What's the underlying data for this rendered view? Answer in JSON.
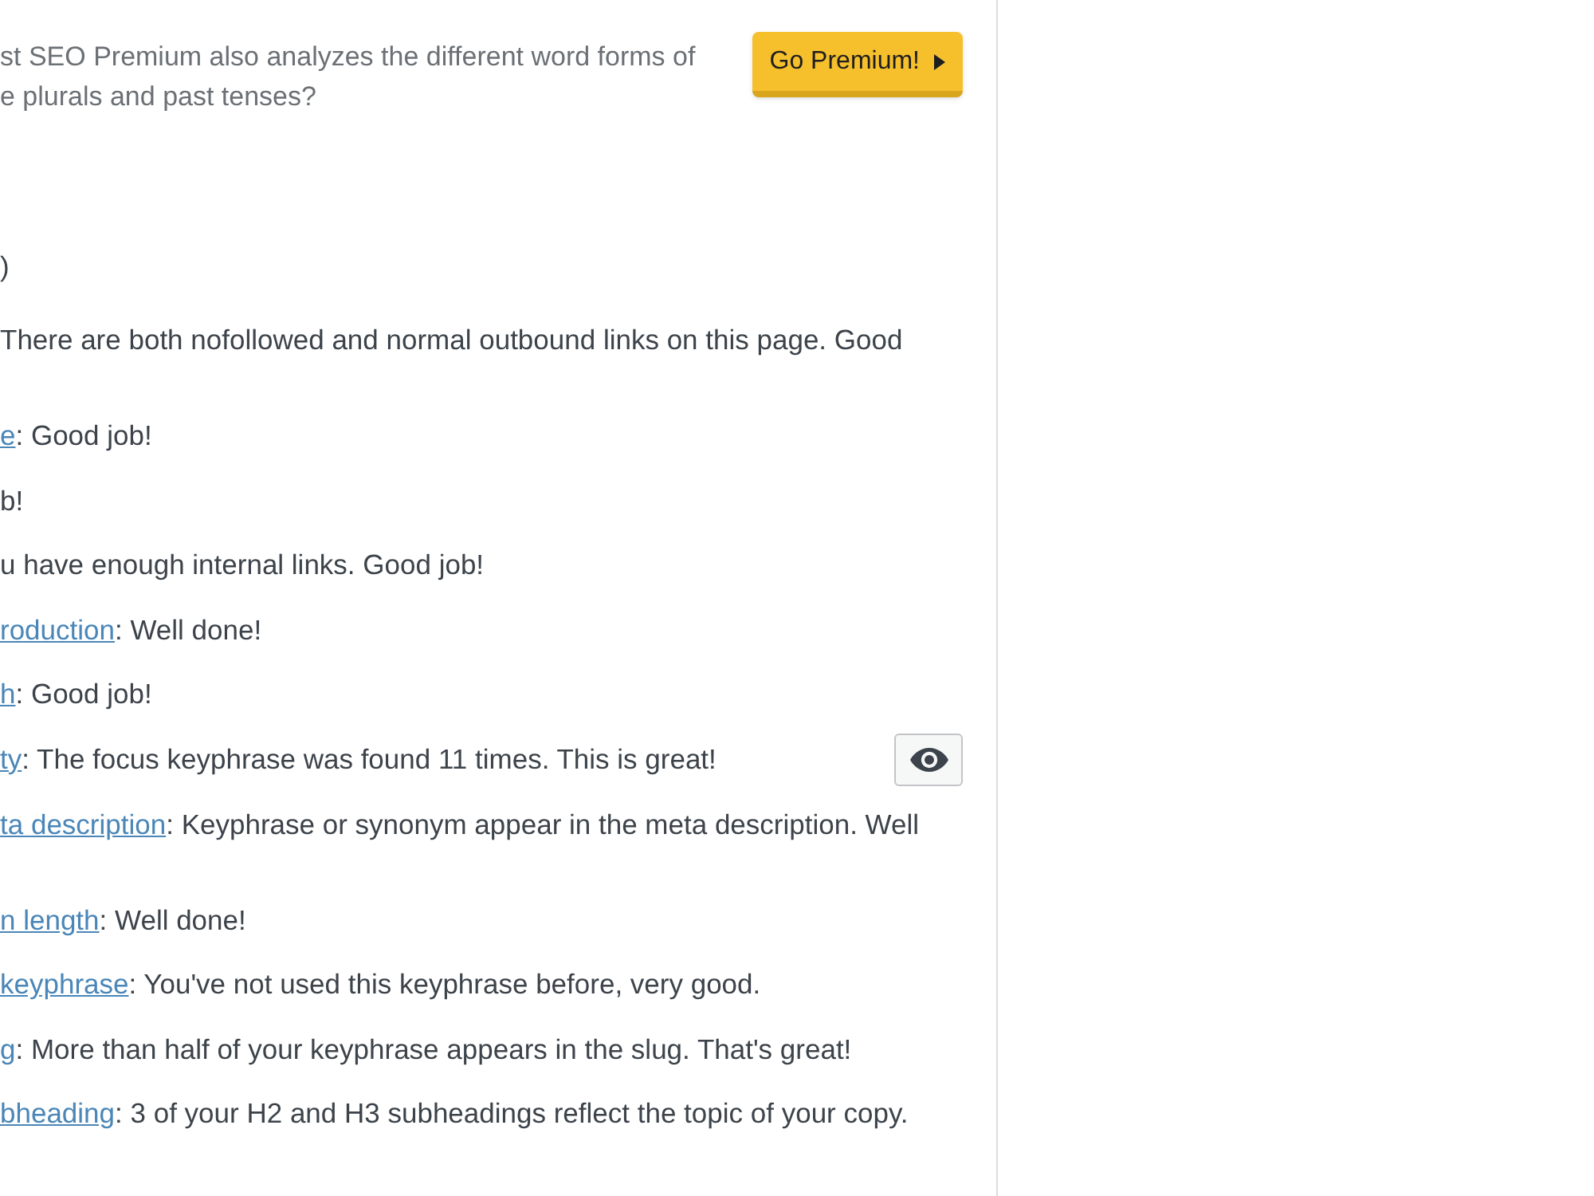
{
  "upsell": {
    "text_lines": [
      "st SEO Premium also analyzes the different word forms of",
      "e plurals and past tenses?"
    ],
    "button": "Go Premium!"
  },
  "section_fragment": ")",
  "results": [
    {
      "kind": "wrapped",
      "text": "There are both nofollowed and normal outbound links on this page. Good",
      "eye_button": false
    },
    {
      "kind": "single",
      "link": "e",
      "text": ": Good job!",
      "eye_button": false
    },
    {
      "kind": "single",
      "text": "b!",
      "eye_button": false
    },
    {
      "kind": "single",
      "text": "u have enough internal links. Good job!",
      "eye_button": false
    },
    {
      "kind": "single",
      "link": "roduction",
      "text": ": Well done!",
      "eye_button": false
    },
    {
      "kind": "single",
      "link": "h",
      "text": ": Good job!",
      "eye_button": false
    },
    {
      "kind": "single",
      "link": "ty",
      "text": ": The focus keyphrase was found 11 times. This is great!",
      "eye_button": true
    },
    {
      "kind": "wrapped",
      "link": "ta description",
      "text": ": Keyphrase or synonym appear in the meta description. Well",
      "eye_button": false
    },
    {
      "kind": "single",
      "link": "n length",
      "text": ": Well done!",
      "eye_button": false
    },
    {
      "kind": "single",
      "link": "keyphrase",
      "text": ": You've not used this keyphrase before, very good.",
      "eye_button": false
    },
    {
      "kind": "single",
      "link": "g",
      "text": ": More than half of your keyphrase appears in the slug. That's great!",
      "eye_button": false
    },
    {
      "kind": "single",
      "link": "bheading",
      "text": ": 3 of your H2 and H3 subheadings reflect the topic of your copy.",
      "eye_button": false
    }
  ]
}
